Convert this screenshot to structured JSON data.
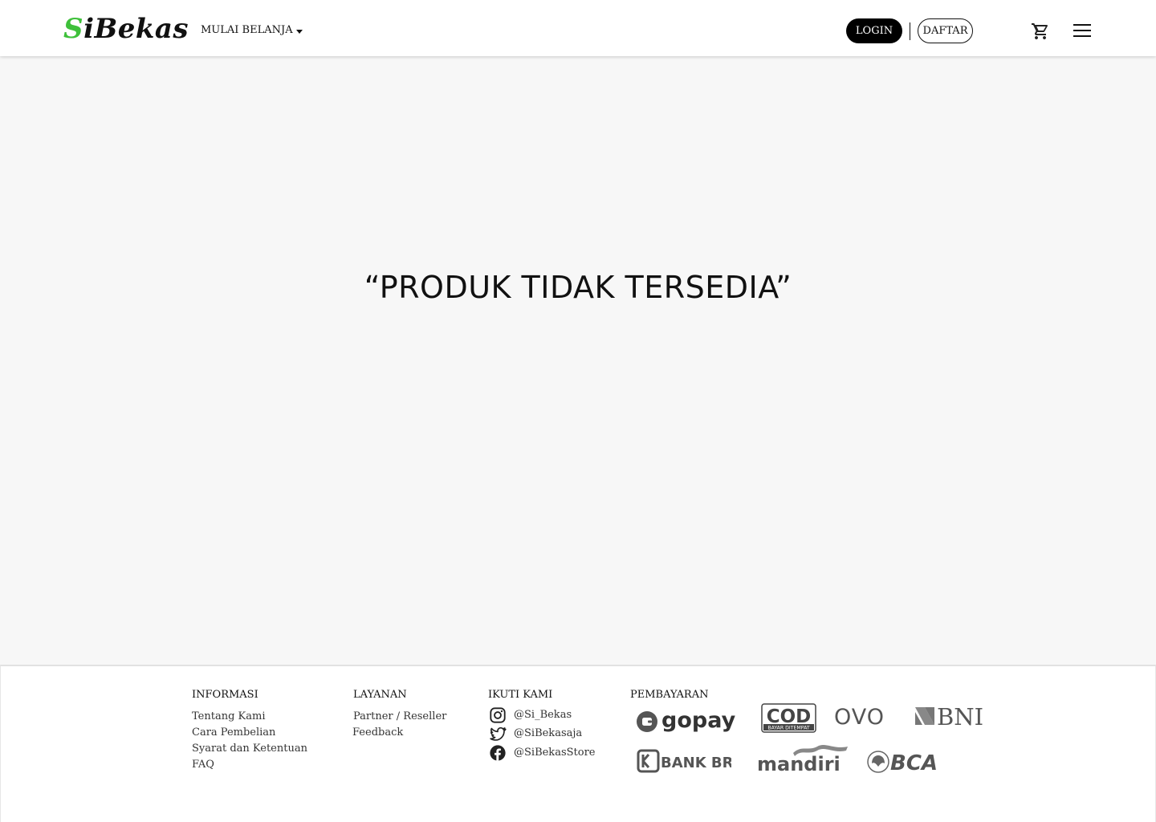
{
  "header": {
    "logo_first": "S",
    "logo_rest": "iBekas",
    "nav_shop_label": "MULAI BELANJA",
    "login_label": "LOGIN",
    "register_label": "DAFTAR",
    "cart_icon": "cart-icon",
    "menu_icon": "hamburger-menu-icon"
  },
  "main": {
    "empty_message": "“PRODUK TIDAK TERSEDIA”"
  },
  "footer": {
    "informasi": {
      "title": "INFORMASI",
      "links": [
        "Tentang Kami",
        "Cara Pembelian",
        "Syarat dan Ketentuan",
        "FAQ"
      ]
    },
    "layanan": {
      "title": "LAYANAN",
      "links": [
        "Partner / Reseller",
        "Feedback"
      ]
    },
    "ikuti_kami": {
      "title": "IKUTI KAMI",
      "socials": [
        {
          "icon": "instagram-icon",
          "handle": "@Si_Bekas"
        },
        {
          "icon": "twitter-icon",
          "handle": "@SiBekasaja"
        },
        {
          "icon": "facebook-icon",
          "handle": "@SiBekasStore"
        }
      ]
    },
    "pembayaran": {
      "title": "PEMBAYARAN",
      "logos": {
        "gopay": "gopay",
        "cod": "COD",
        "cod_sub": "BAYAR DITEMPAT",
        "ovo": "OVO",
        "bni": "BNI",
        "bri": "BANK BRI",
        "mandiri": "mandiri",
        "bca": "BCA"
      }
    }
  },
  "colors": {
    "brand_green": "#3ec03a",
    "page_bg": "#f7f7f7",
    "payment_logo_gray": "#555555"
  }
}
